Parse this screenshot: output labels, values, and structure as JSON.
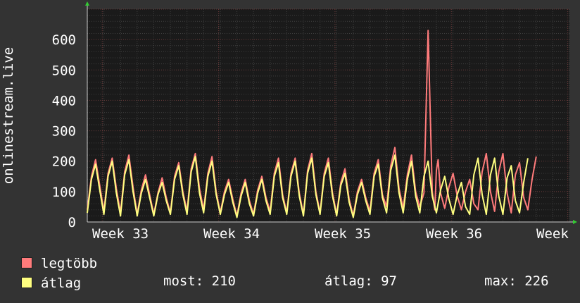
{
  "chart_data": {
    "type": "line",
    "ylabel": "onlinestream.live",
    "ylim": [
      0,
      700
    ],
    "yticks": [
      0,
      100,
      200,
      300,
      400,
      500,
      600
    ],
    "x_ticks": [
      "Week 33",
      "Week 34",
      "Week 35",
      "Week 36",
      "Week"
    ],
    "grid": true,
    "x_range_days": [
      0,
      29
    ],
    "series": [
      {
        "name": "legtöbb",
        "color": "#ff7b7b",
        "x_days": [
          0,
          0.25,
          0.5,
          0.75,
          1,
          1.25,
          1.5,
          1.75,
          2,
          2.25,
          2.5,
          2.75,
          3,
          3.25,
          3.5,
          3.75,
          4,
          4.25,
          4.5,
          4.75,
          5,
          5.25,
          5.5,
          5.75,
          6,
          6.25,
          6.5,
          6.75,
          7,
          7.25,
          7.5,
          7.75,
          8,
          8.25,
          8.5,
          8.75,
          9,
          9.25,
          9.5,
          9.75,
          10,
          10.25,
          10.5,
          10.75,
          11,
          11.25,
          11.5,
          11.75,
          12,
          12.25,
          12.5,
          12.75,
          13,
          13.25,
          13.5,
          13.75,
          14,
          14.25,
          14.5,
          14.75,
          15,
          15.25,
          15.5,
          15.75,
          16,
          16.25,
          16.5,
          16.75,
          17,
          17.25,
          17.5,
          17.75,
          18,
          18.25,
          18.5,
          18.75,
          19,
          19.25,
          19.5,
          19.75,
          20,
          20.25,
          20.5,
          20.75,
          20.9,
          21,
          21.1,
          21.25,
          21.5,
          21.75,
          22,
          22.25,
          22.5,
          22.75,
          23,
          23.25,
          23.5,
          23.75,
          24,
          24.25,
          24.5,
          24.75,
          25,
          25.25,
          25.5,
          25.75,
          26,
          26.25,
          26.5,
          26.75,
          27,
          27.25,
          27.5,
          27.75,
          28,
          28.25,
          28.5,
          28.75,
          29
        ],
        "values": [
          40,
          150,
          205,
          120,
          35,
          160,
          210,
          110,
          30,
          165,
          220,
          115,
          25,
          105,
          155,
          90,
          25,
          95,
          145,
          80,
          30,
          150,
          195,
          100,
          35,
          175,
          225,
          110,
          40,
          160,
          215,
          100,
          30,
          100,
          140,
          75,
          20,
          95,
          140,
          70,
          25,
          105,
          150,
          80,
          35,
          160,
          210,
          90,
          30,
          160,
          210,
          95,
          25,
          170,
          225,
          100,
          30,
          160,
          210,
          95,
          25,
          130,
          175,
          75,
          20,
          100,
          140,
          80,
          35,
          160,
          205,
          90,
          50,
          185,
          245,
          110,
          45,
          155,
          220,
          100,
          50,
          95,
          630,
          100,
          40,
          170,
          205,
          95,
          45,
          115,
          160,
          85,
          40,
          100,
          140,
          60,
          40,
          165,
          225,
          100,
          35,
          165,
          225,
          95,
          30,
          155,
          195,
          80,
          40,
          140,
          215
        ]
      },
      {
        "name": "átlag",
        "color": "#ffff80",
        "x_days": [
          0,
          0.25,
          0.5,
          0.75,
          1,
          1.25,
          1.5,
          1.75,
          2,
          2.25,
          2.5,
          2.75,
          3,
          3.25,
          3.5,
          3.75,
          4,
          4.25,
          4.5,
          4.75,
          5,
          5.25,
          5.5,
          5.75,
          6,
          6.25,
          6.5,
          6.75,
          7,
          7.25,
          7.5,
          7.75,
          8,
          8.25,
          8.5,
          8.75,
          9,
          9.25,
          9.5,
          9.75,
          10,
          10.25,
          10.5,
          10.75,
          11,
          11.25,
          11.5,
          11.75,
          12,
          12.25,
          12.5,
          12.75,
          13,
          13.25,
          13.5,
          13.75,
          14,
          14.25,
          14.5,
          14.75,
          15,
          15.25,
          15.5,
          15.75,
          16,
          16.25,
          16.5,
          16.75,
          17,
          17.25,
          17.5,
          17.75,
          18,
          18.25,
          18.5,
          18.75,
          19,
          19.25,
          19.5,
          19.75,
          20,
          20.25,
          20.5,
          20.75,
          21,
          21.25,
          21.5,
          21.75,
          22,
          22.25,
          22.5,
          22.75,
          23,
          23.25,
          23.5,
          23.75,
          24,
          24.25,
          24.5,
          24.75,
          25,
          25.25,
          25.5,
          25.75,
          26,
          26.25,
          26.5,
          26.75,
          27,
          27.25,
          27.5,
          27.75,
          28,
          28.25,
          28.5,
          28.75,
          29
        ],
        "values": [
          30,
          140,
          190,
          105,
          25,
          150,
          200,
          95,
          20,
          155,
          205,
          100,
          20,
          95,
          140,
          80,
          20,
          90,
          130,
          70,
          25,
          140,
          185,
          90,
          25,
          165,
          215,
          95,
          30,
          150,
          200,
          90,
          25,
          90,
          130,
          65,
          15,
          85,
          130,
          60,
          20,
          95,
          140,
          70,
          25,
          150,
          195,
          80,
          25,
          150,
          200,
          85,
          20,
          160,
          210,
          90,
          25,
          150,
          195,
          85,
          20,
          120,
          160,
          65,
          15,
          90,
          130,
          70,
          25,
          150,
          190,
          80,
          30,
          170,
          220,
          95,
          30,
          140,
          200,
          85,
          30,
          150,
          200,
          85,
          30,
          105,
          150,
          75,
          25,
          90,
          130,
          50,
          25,
          155,
          210,
          90,
          25,
          155,
          210,
          85,
          25,
          145,
          185,
          70,
          30,
          130,
          210
        ]
      }
    ],
    "legend": [
      {
        "label": "legtöbb",
        "color": "#ff7b7b"
      },
      {
        "label": "átlag",
        "color": "#ffff80"
      }
    ],
    "stats": {
      "most": "most: 210",
      "atlag": "átlag: 97",
      "max": "max: 226"
    }
  }
}
